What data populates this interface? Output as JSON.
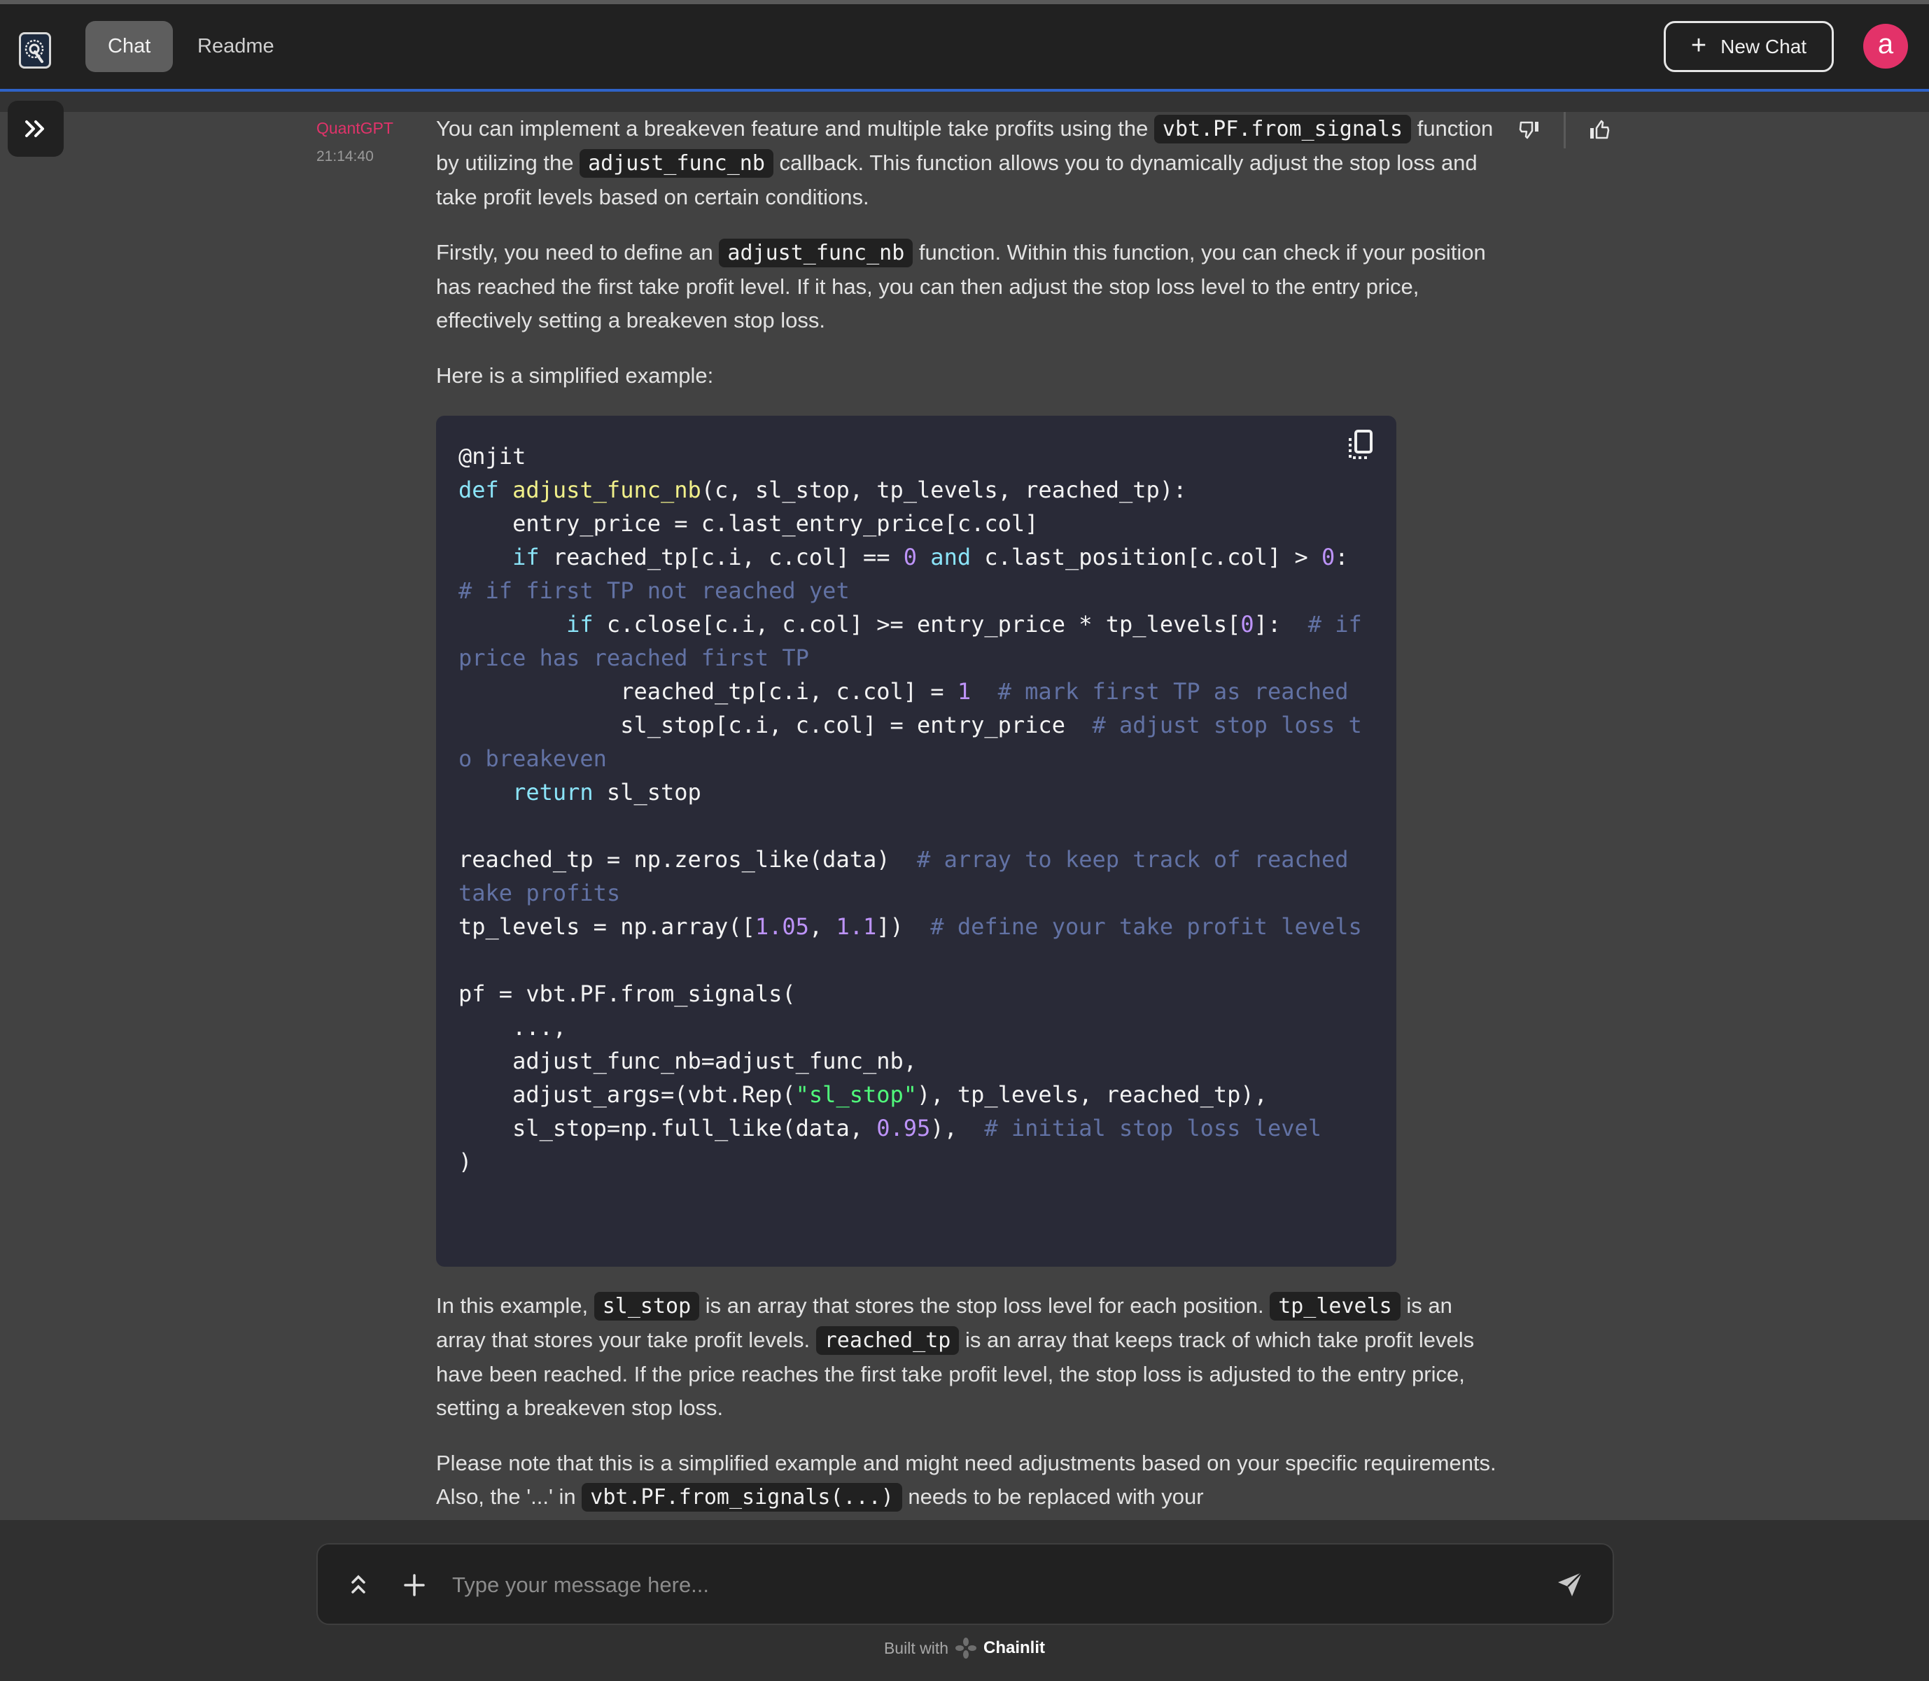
{
  "header": {
    "logo_alt": "QuantGPT logo",
    "tabs": [
      {
        "label": "Chat",
        "active": true
      },
      {
        "label": "Readme",
        "active": false
      }
    ],
    "new_chat_label": "New Chat",
    "avatar_initial": "a"
  },
  "colors": {
    "accent_pink": "#e33269",
    "header_line_blue": "#2f63c8",
    "code_bg": "#292a37"
  },
  "message": {
    "author": "QuantGPT",
    "time": "21:14:40",
    "feedback": {
      "thumbs_down": "thumbs-down-icon",
      "thumbs_up": "thumbs-up-icon"
    },
    "p1": {
      "t1": "You can implement a breakeven feature and multiple take profits using the ",
      "c1": "vbt.PF.from_signals",
      "t2": " function by utilizing the ",
      "c2": "adjust_func_nb",
      "t3": " callback. This function allows you to dynamically adjust the stop loss and take profit levels based on certain conditions."
    },
    "p2": {
      "t1": "Firstly, you need to define an ",
      "c1": "adjust_func_nb",
      "t2": " function. Within this function, you can check if your position has reached the first take profit level. If it has, you can then adjust the stop loss level to the entry price, effectively setting a breakeven stop loss."
    },
    "p3": "Here is a simplified example:",
    "code": {
      "copy_icon": "copy-icon",
      "lines": {
        "l1": "@njit",
        "l2_kw": "def",
        "l2_fn": "adjust_func_nb",
        "l2_rest": "(c, sl_stop, tp_levels, reached_tp):",
        "l3": "    entry_price = c.last_entry_price[c.col]",
        "l4_indent": "    ",
        "l4_kw": "if",
        "l4_a": " reached_tp[c.i, c.col] == ",
        "l4_num": "0",
        "l4_and": "and",
        "l4_b": " c.last_position[c.col] > ",
        "l4_num2": "0",
        "l4_c": ":  ",
        "l4_cm": "# if first TP not reached yet",
        "l5_indent": "        ",
        "l5_kw": "if",
        "l5_a": " c.close[c.i, c.col] >= entry_price * tp_levels[",
        "l5_num": "0",
        "l5_b": "]:  ",
        "l5_cm": "# if price has reached first TP",
        "l6_a": "            reached_tp[c.i, c.col] = ",
        "l6_num": "1",
        "l6_cm": "# mark first TP as reached",
        "l7_a": "            sl_stop[c.i, c.col] = entry_price  ",
        "l7_cm": "# adjust stop loss to breakeven",
        "l8_indent": "    ",
        "l8_kw": "return",
        "l8_rest": " sl_stop",
        "l9_a": "reached_tp = np.zeros_like(data)  ",
        "l9_cm": "# array to keep track of reached take profits",
        "l10_a": "tp_levels = np.array([",
        "l10_n1": "1.05",
        "l10_b": ", ",
        "l10_n2": "1.1",
        "l10_c": "])  ",
        "l10_cm": "# define your take profit levels",
        "l11": "pf = vbt.PF.from_signals(",
        "l12": "    ...,",
        "l13": "    adjust_func_nb=adjust_func_nb,",
        "l14_a": "    adjust_args=(vbt.Rep(",
        "l14_str": "\"sl_stop\"",
        "l14_b": "), tp_levels, reached_tp),",
        "l15_a": "    sl_stop=np.full_like(data, ",
        "l15_num": "0.95",
        "l15_b": "),  ",
        "l15_cm": "# initial stop loss level",
        "l16": ")"
      }
    },
    "p4": {
      "t1": "In this example, ",
      "c1": "sl_stop",
      "t2": " is an array that stores the stop loss level for each position. ",
      "c2": "tp_levels",
      "t3": " is an array that stores your take profit levels. ",
      "c3": "reached_tp",
      "t4": " is an array that keeps track of which take profit levels have been reached. If the price reaches the first take profit level, the stop loss is adjusted to the entry price, setting a breakeven stop loss."
    },
    "p5": {
      "t1": "Please note that this is a simplified example and might need adjustments based on your specific requirements. Also, the '...' in ",
      "c1": "vbt.PF.from_signals(...)",
      "t2": " needs to be replaced with your"
    }
  },
  "composer": {
    "placeholder": "Type your message here...",
    "value": ""
  },
  "footer": {
    "built_with": "Built with",
    "brand": "Chainlit"
  }
}
